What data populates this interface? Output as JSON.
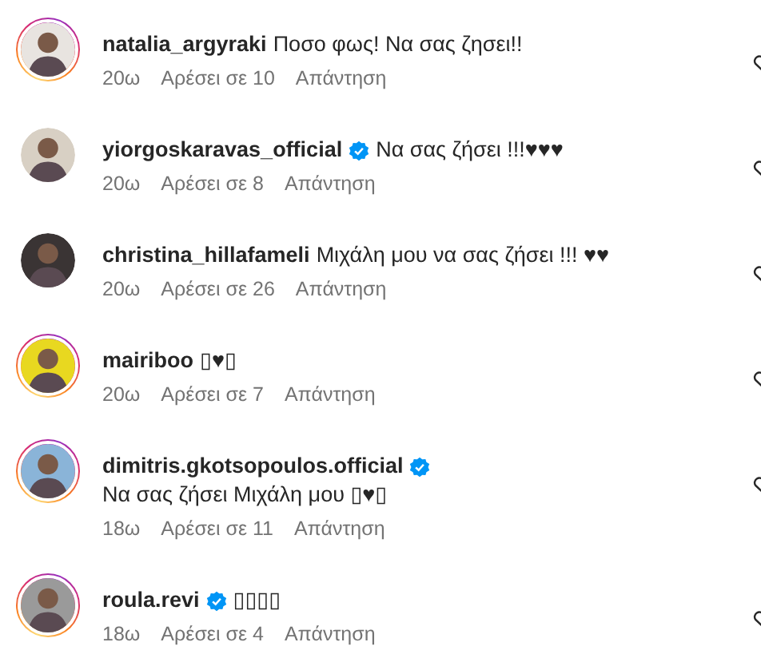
{
  "comments": [
    {
      "username": "natalia_argyraki",
      "verified": false,
      "story_ring": true,
      "text": "Ποσο φως! Να σας ζησει!!",
      "time": "20ω",
      "likes": "Αρέσει σε 10",
      "reply": "Απάντηση"
    },
    {
      "username": "yiorgoskaravas_official",
      "verified": true,
      "story_ring": false,
      "text": "Να σας ζήσει !!!♥♥♥",
      "time": "20ω",
      "likes": "Αρέσει σε 8",
      "reply": "Απάντηση"
    },
    {
      "username": "christina_hillafameli",
      "verified": false,
      "story_ring": false,
      "text": "Μιχάλη μου να σας ζήσει !!! ♥♥",
      "time": "20ω",
      "likes": "Αρέσει σε 26",
      "reply": "Απάντηση"
    },
    {
      "username": "mairiboo",
      "verified": false,
      "story_ring": true,
      "text": "▯♥▯",
      "time": "20ω",
      "likes": "Αρέσει σε 7",
      "reply": "Απάντηση"
    },
    {
      "username": "dimitris.gkotsopoulos.official",
      "verified": true,
      "story_ring": true,
      "text": "Να σας ζήσει Μιχάλη μου ▯♥▯",
      "time": "18ω",
      "likes": "Αρέσει σε 11",
      "reply": "Απάντηση"
    },
    {
      "username": "roula.revi",
      "verified": true,
      "story_ring": true,
      "text": "▯▯▯▯",
      "time": "18ω",
      "likes": "Αρέσει σε 4",
      "reply": "Απάντηση"
    }
  ]
}
